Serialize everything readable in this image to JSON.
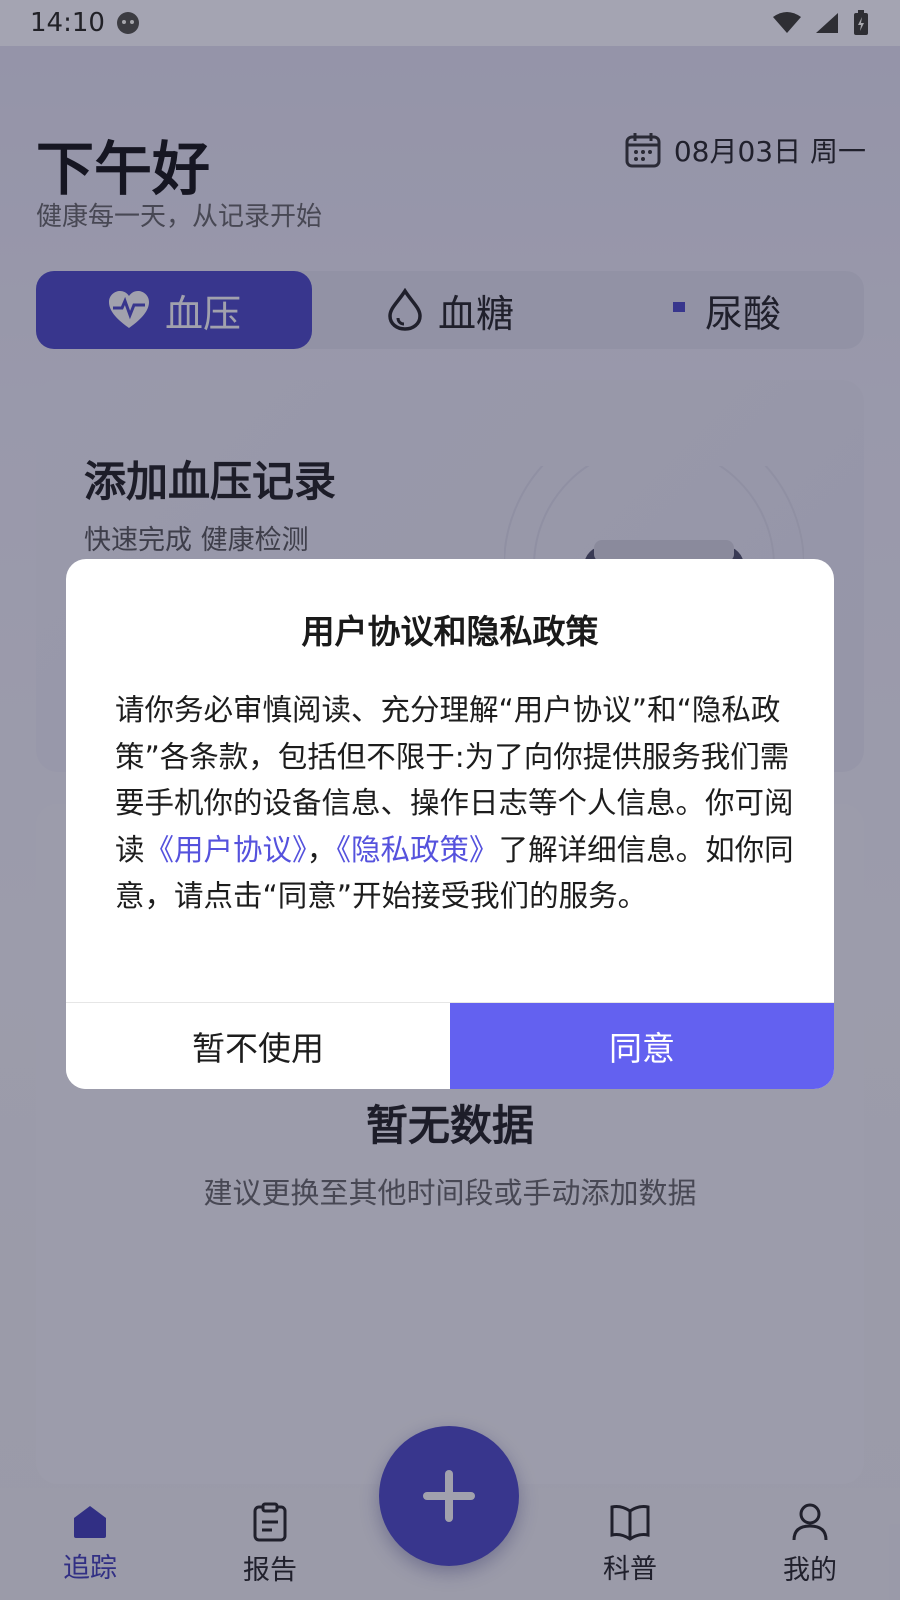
{
  "status_bar": {
    "time": "14:10"
  },
  "header": {
    "greeting": "下午好",
    "subtitle": "健康每一天，从记录开始",
    "date": "08月03日 周一"
  },
  "tabs": [
    {
      "label": "血压",
      "icon": "heart-pulse-icon",
      "active": true
    },
    {
      "label": "血糖",
      "icon": "drop-icon",
      "active": false
    },
    {
      "label": "尿酸",
      "icon": "uric-acid-icon",
      "active": false
    }
  ],
  "add_card": {
    "title": "添加血压记录",
    "subtitle": "快速完成 健康检测"
  },
  "data_card": {
    "empty_title": "暂无数据",
    "empty_subtitle": "建议更换至其他时间段或手动添加数据"
  },
  "bottom_nav": [
    {
      "label": "追踪",
      "icon": "home-icon",
      "active": true
    },
    {
      "label": "报告",
      "icon": "clipboard-icon",
      "active": false
    },
    {
      "label": "科普",
      "icon": "book-icon",
      "active": false
    },
    {
      "label": "我的",
      "icon": "user-icon",
      "active": false
    }
  ],
  "dialog": {
    "title": "用户协议和隐私政策",
    "body_part1": "请你务必审慎阅读、充分理解“用户协议”和“隐私政策”各条款，包括但不限于:为了向你提供服务我们需要手机你的设备信息、操作日志等个人信息。你可阅读",
    "link_user_agreement": "《用户协议》",
    "separator": "，",
    "link_privacy_policy": "《隐私政策》",
    "body_part2": "了解详细信息。如你同意，请点击“同意”开始接受我们的服务。",
    "decline_label": "暂不使用",
    "agree_label": "同意"
  },
  "colors": {
    "accent": "#4b48c8",
    "agree_button": "#6361f0",
    "link": "#5552dd"
  }
}
